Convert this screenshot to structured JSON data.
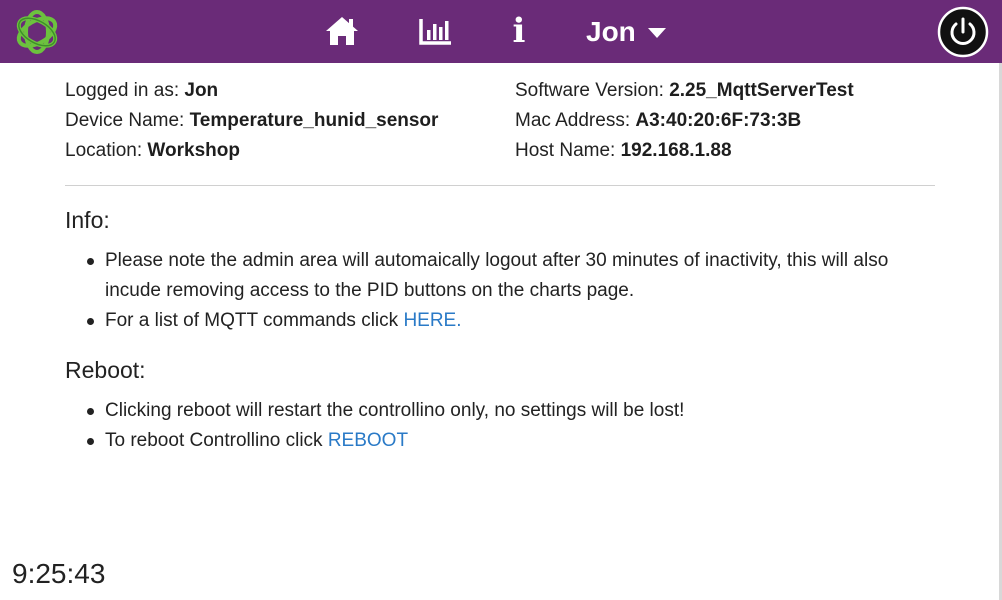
{
  "colors": {
    "navbar": "#6a2b78",
    "link": "#2a7ac7",
    "logo_green": "#6cc23e"
  },
  "navbar": {
    "logo_icon": "controllino-logo-icon",
    "home_icon": "home-icon",
    "charts_icon": "bar-chart-icon",
    "info_glyph": "i",
    "user_name": "Jon",
    "power_icon": "power-icon"
  },
  "device_info": {
    "logged_in_label": "Logged in as: ",
    "logged_in_value": "Jon",
    "device_name_label": "Device Name: ",
    "device_name_value": "Temperature_hunid_sensor",
    "location_label": "Location: ",
    "location_value": "Workshop",
    "software_version_label": "Software Version: ",
    "software_version_value": "2.25_MqttServerTest",
    "mac_address_label": "Mac Address: ",
    "mac_address_value": "A3:40:20:6F:73:3B",
    "host_name_label": "Host Name: ",
    "host_name_value": "192.168.1.88"
  },
  "info_section": {
    "title": "Info:",
    "bullet1": "Please note the admin area will automaically logout after 30 minutes of inactivity, this will also incude removing access to the PID buttons on the charts page.",
    "bullet2_text": "For a list of MQTT commands click ",
    "bullet2_link": "HERE."
  },
  "reboot_section": {
    "title": "Reboot:",
    "bullet1": "Clicking reboot will restart the controllino only, no settings will be lost!",
    "bullet2_text": "To reboot Controllino click ",
    "bullet2_link": "REBOOT"
  },
  "clock": "9:25:43"
}
